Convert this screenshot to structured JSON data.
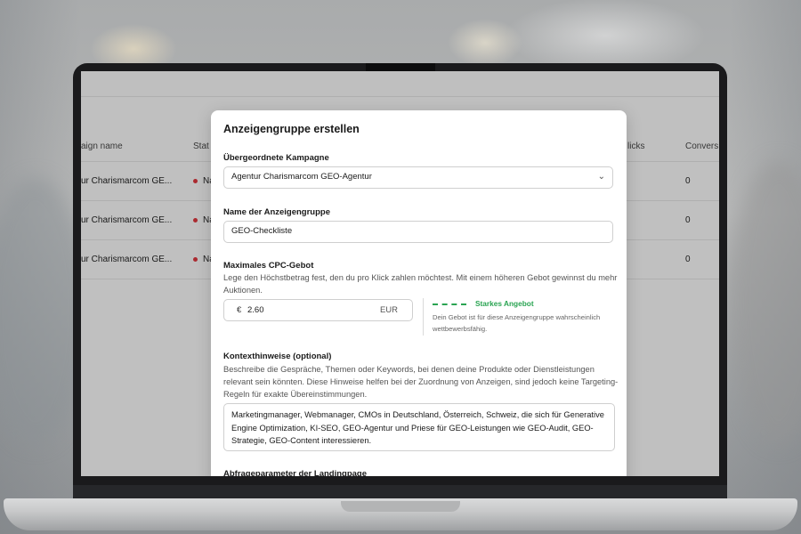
{
  "table": {
    "headers": {
      "campaign_name": "aign name",
      "status": "Stat",
      "clicks": "licks",
      "conversions": "Convers"
    },
    "rows": [
      {
        "campaign_name": "ur Charismarcom GE...",
        "status": "Na",
        "conversions": "0"
      },
      {
        "campaign_name": "ur Charismarcom GE...",
        "status": "Na",
        "conversions": "0"
      },
      {
        "campaign_name": "ur Charismarcom GE...",
        "status": "Na",
        "conversions": "0"
      }
    ],
    "status_color": "#d1343b"
  },
  "modal": {
    "title": "Anzeigengruppe erstellen",
    "parent_campaign": {
      "label": "Übergeordnete Kampagne",
      "value": "Agentur Charismarcom GEO-Agentur"
    },
    "ad_group_name": {
      "label": "Name der Anzeigengruppe",
      "value": "GEO-Checkliste"
    },
    "max_cpc": {
      "label": "Maximales CPC-Gebot",
      "help": "Lege den Höchstbetrag fest, den du pro Klick zahlen möchtest. Mit einem höheren Gebot gewinnst du mehr Auktionen.",
      "currency_symbol": "€",
      "value": "2.60",
      "unit": "EUR",
      "strength_label": "Starkes Angebot",
      "strength_description": "Dein Gebot ist für diese Anzeigengruppe wahrscheinlich wettbewerbsfähig.",
      "strength_color": "#2aa452"
    },
    "context_hints": {
      "label": "Kontexthinweise (optional)",
      "help": "Beschreibe die Gespräche, Themen oder Keywords, bei denen deine Produkte oder Dienstleistungen relevant sein könnten. Diese Hinweise helfen bei der Zuordnung von Anzeigen, sind jedoch keine Targeting-Regeln für exakte Übereinstimmungen.",
      "value": "Marketingmanager, Webmanager, CMOs in Deutschland, Österreich, Schweiz, die sich für Generative Engine Optimization, KI-SEO, GEO-Agentur und Priese für GEO-Leistungen wie GEO-Audit, GEO-Strategie, GEO-Content interessieren."
    },
    "landing_params": {
      "label": "Abfrageparameter der Landingpage"
    }
  }
}
